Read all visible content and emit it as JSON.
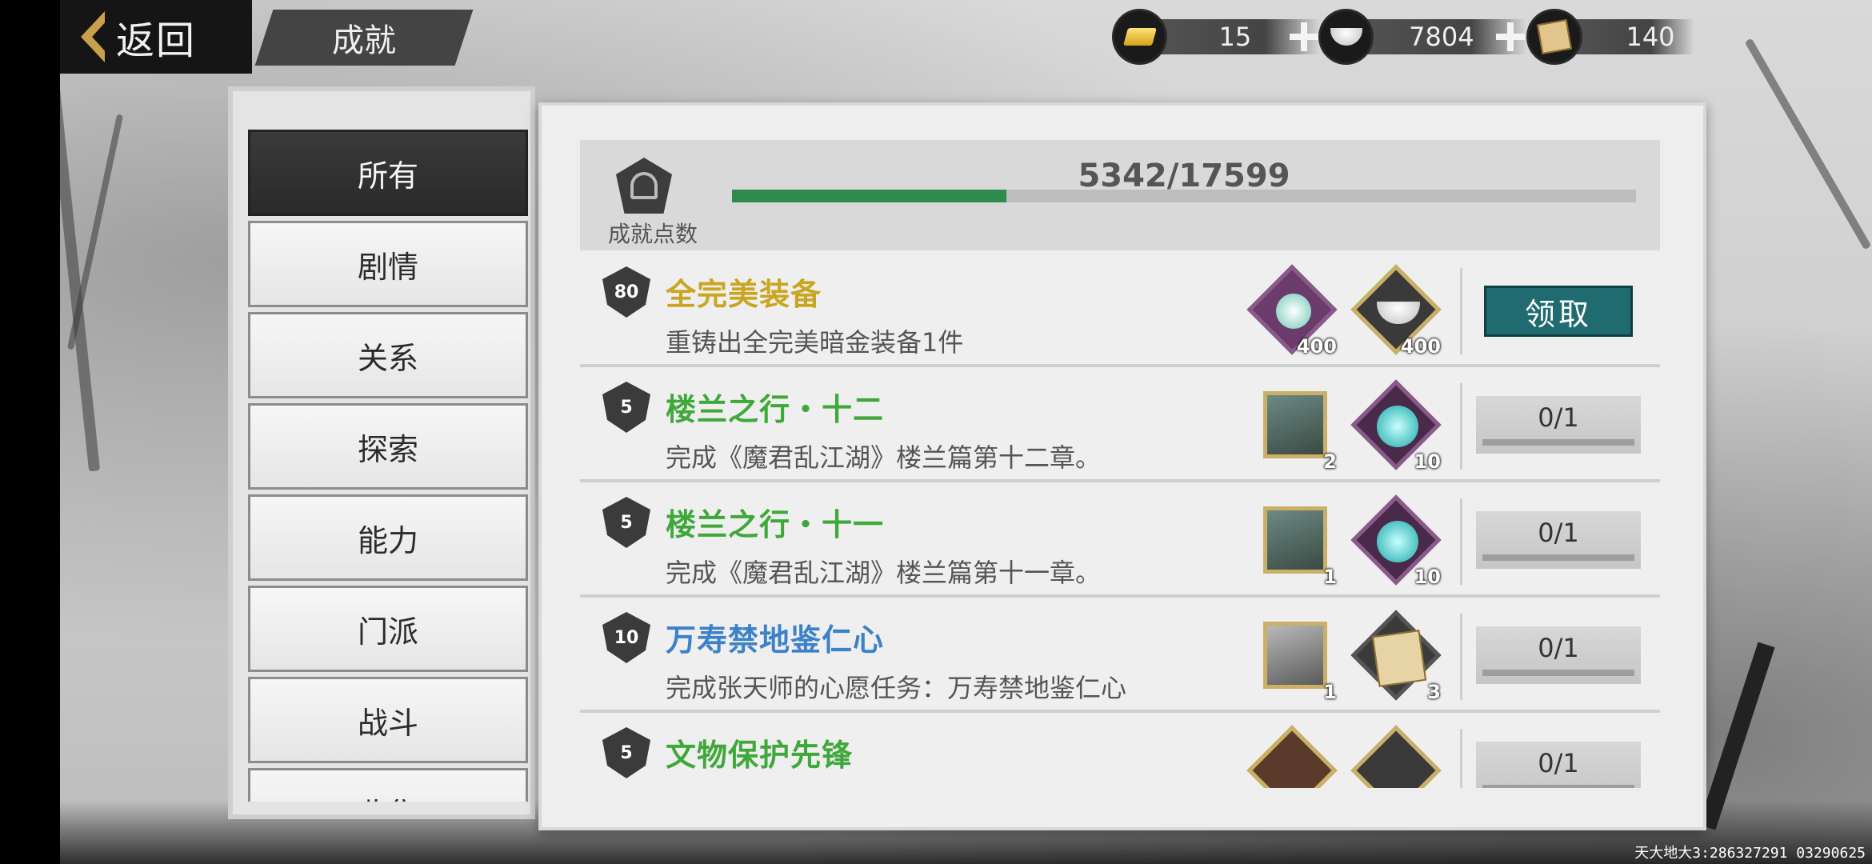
{
  "top_bar": {
    "back_label": "返回",
    "title": "成就",
    "currencies": [
      {
        "icon": "gold-bar-icon",
        "value": "15"
      },
      {
        "icon": "silver-ingot-icon",
        "value": "7804"
      },
      {
        "icon": "scroll-icon",
        "value": "140"
      }
    ]
  },
  "categories": [
    {
      "label": "所有",
      "active": true
    },
    {
      "label": "剧情",
      "active": false
    },
    {
      "label": "关系",
      "active": false
    },
    {
      "label": "探索",
      "active": false
    },
    {
      "label": "能力",
      "active": false
    },
    {
      "label": "门派",
      "active": false
    },
    {
      "label": "战斗",
      "active": false
    },
    {
      "label": "收集",
      "active": false
    }
  ],
  "achievement_points": {
    "label": "成就点数",
    "current": 5342,
    "total": 17599,
    "text": "5342/17599"
  },
  "achievements": [
    {
      "level": "80",
      "name": "全完美装备",
      "name_color": "#c9a622",
      "desc": "重铸出全完美暗金装备1件",
      "rewards": [
        {
          "icon": "jade-orb-icon",
          "count": "400"
        },
        {
          "icon": "silver-ingot-icon",
          "count": "400"
        }
      ],
      "action": "领取",
      "claimable": true
    },
    {
      "level": "5",
      "name": "楼兰之行・十二",
      "name_color": "#3fa83a",
      "desc": "完成《魔君乱江湖》楼兰篇第十二章。",
      "rewards": [
        {
          "icon": "hero-portrait-icon",
          "count": "2"
        },
        {
          "icon": "cyan-orb-icon",
          "count": "10"
        }
      ],
      "progress": "0/1",
      "claimable": false
    },
    {
      "level": "5",
      "name": "楼兰之行・十一",
      "name_color": "#3fa83a",
      "desc": "完成《魔君乱江湖》楼兰篇第十一章。",
      "rewards": [
        {
          "icon": "hero-portrait-icon",
          "count": "1"
        },
        {
          "icon": "cyan-orb-icon",
          "count": "10"
        }
      ],
      "progress": "0/1",
      "claimable": false
    },
    {
      "level": "10",
      "name": "万寿禁地鉴仁心",
      "name_color": "#3c82c8",
      "desc": "完成张天师的心愿任务：万寿禁地鉴仁心",
      "rewards": [
        {
          "icon": "elder-portrait-icon",
          "count": "1"
        },
        {
          "icon": "map-scroll-icon",
          "count": "3"
        }
      ],
      "progress": "0/1",
      "claimable": false
    },
    {
      "level": "5",
      "name": "文物保护先锋",
      "name_color": "#3fa83a",
      "desc": "",
      "rewards": [
        {
          "icon": "seal-icon",
          "count": ""
        },
        {
          "icon": "silver-ingot-icon",
          "count": ""
        }
      ],
      "progress": "0/1",
      "claimable": false
    }
  ],
  "footer": "天大地大3:286327291  03290625",
  "colors": {
    "accent": "#1f6b6f",
    "progress_fill": "#2f8a4d",
    "reward_frame": "#c9b066"
  }
}
